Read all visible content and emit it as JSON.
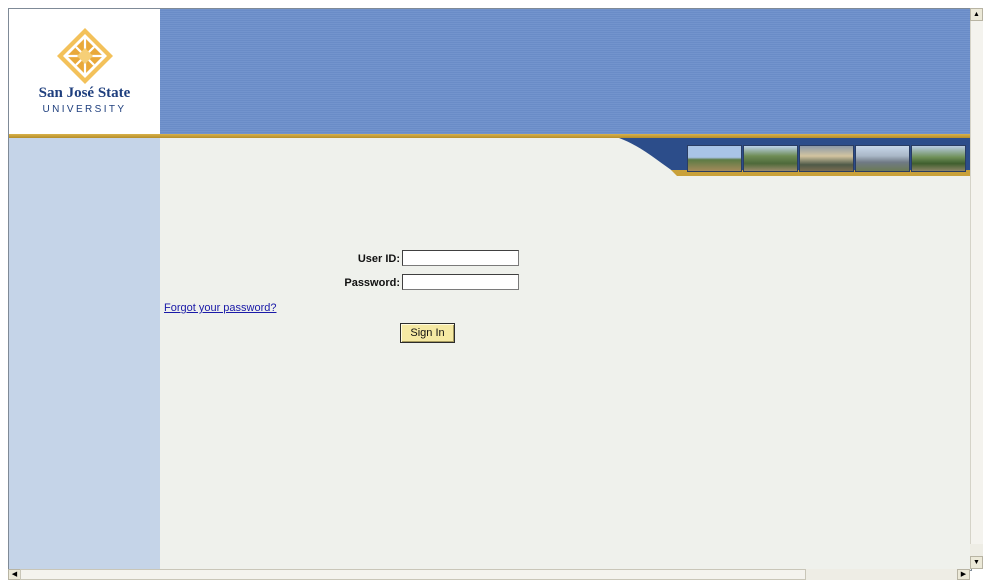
{
  "logo": {
    "name": "San José State",
    "sub": "UNIVERSITY"
  },
  "login": {
    "user_id_label": "User ID:",
    "password_label": "Password:",
    "forgot_link": "Forgot your password?",
    "sign_in_label": "Sign In"
  },
  "colors": {
    "banner_blue": "#6a8cc7",
    "gold": "#d8b24a",
    "navy": "#1f3f7e",
    "left_panel": "#c5d4e8",
    "content_bg": "#eff1ec",
    "button_yellow": "#f5e9a3"
  },
  "icons": {
    "logo_mark": "diamond-lattice-logo",
    "scroll_up": "arrow-up-icon",
    "scroll_down": "arrow-down-icon",
    "scroll_left": "arrow-left-icon",
    "scroll_right": "arrow-right-icon"
  }
}
